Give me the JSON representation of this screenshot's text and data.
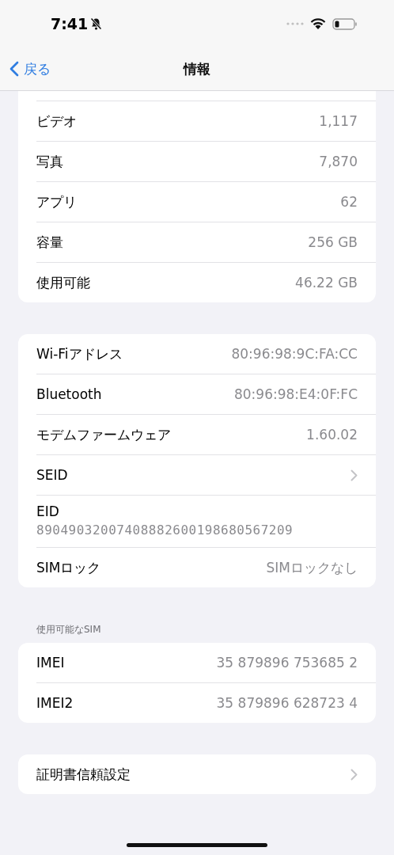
{
  "status_bar": {
    "time": "7:41",
    "silent": true
  },
  "nav": {
    "back": "戻る",
    "title": "情報"
  },
  "sections": [
    {
      "cut_top": true,
      "rows": [
        {
          "kind": "value",
          "label": "ビデオ",
          "value": "1,117"
        },
        {
          "kind": "value",
          "label": "写真",
          "value": "7,870"
        },
        {
          "kind": "value",
          "label": "アプリ",
          "value": "62"
        },
        {
          "kind": "value",
          "label": "容量",
          "value": "256 GB"
        },
        {
          "kind": "value",
          "label": "使用可能",
          "value": "46.22 GB"
        }
      ]
    },
    {
      "rows": [
        {
          "kind": "value",
          "label": "Wi-Fiアドレス",
          "value": "80:96:98:9C:FA:CC"
        },
        {
          "kind": "value",
          "label": "Bluetooth",
          "value": "80:96:98:E4:0F:FC"
        },
        {
          "kind": "value",
          "label": "モデムファームウェア",
          "value": "1.60.02"
        },
        {
          "kind": "chevron",
          "label": "SEID"
        },
        {
          "kind": "stacked",
          "label": "EID",
          "value": "89049032007408882600198680567209"
        },
        {
          "kind": "value",
          "label": "SIMロック",
          "value": "SIMロックなし"
        }
      ]
    },
    {
      "header": "使用可能なSIM",
      "rows": [
        {
          "kind": "value",
          "label": "IMEI",
          "value": "35 879896 753685 2"
        },
        {
          "kind": "value",
          "label": "IMEI2",
          "value": "35 879896 628723 4"
        }
      ]
    },
    {
      "rows": [
        {
          "kind": "chevron",
          "label": "証明書信頼設定"
        }
      ]
    }
  ]
}
